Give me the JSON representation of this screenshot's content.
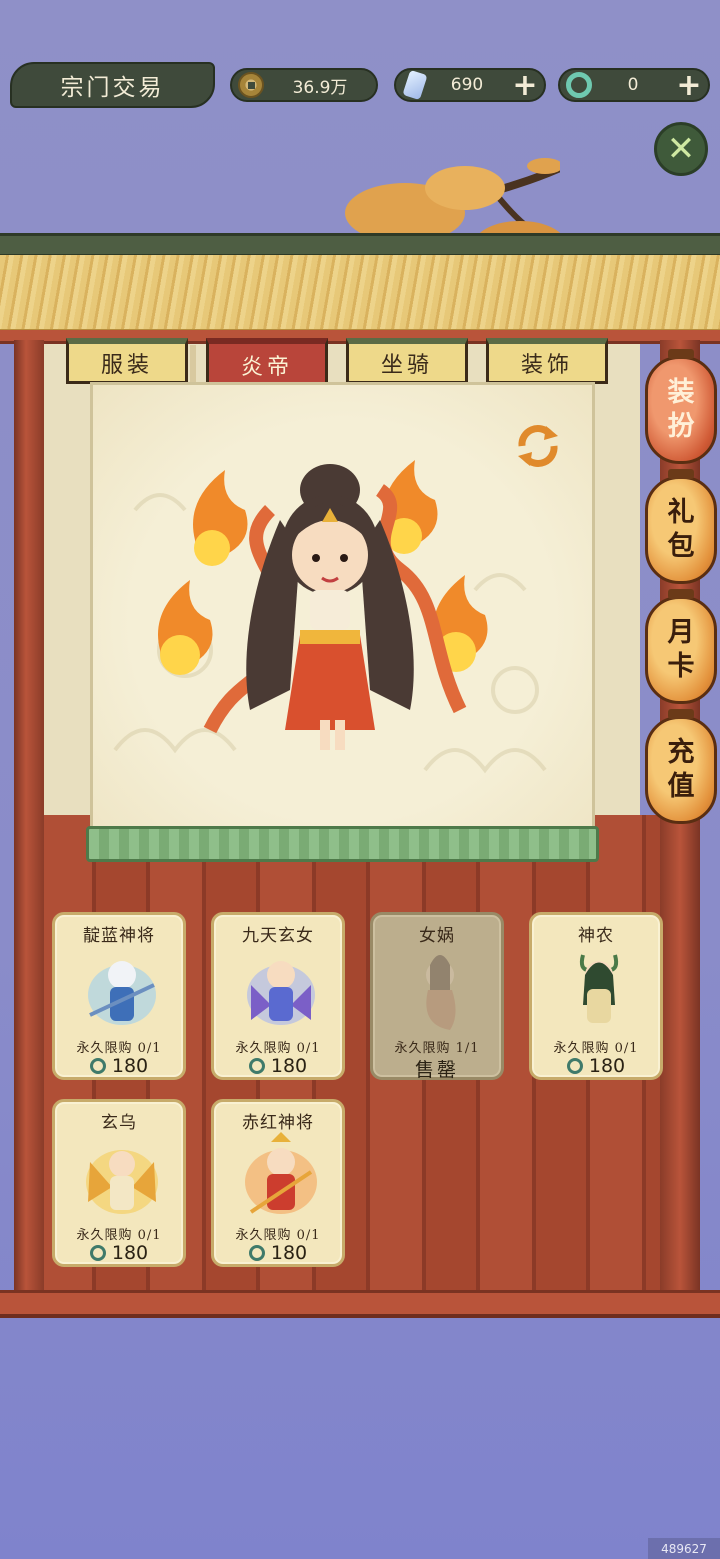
{
  "header": {
    "title": "宗门交易",
    "coins": "36.9万",
    "gems": "690",
    "jade": "0",
    "plus_label": "+",
    "close_label": "✕"
  },
  "tabs": [
    {
      "label": "服装"
    },
    {
      "label": "炎帝"
    },
    {
      "label": "坐骑"
    },
    {
      "label": "装饰"
    }
  ],
  "side_menu": [
    {
      "line1": "装",
      "line2": "扮"
    },
    {
      "line1": "礼",
      "line2": "包"
    },
    {
      "line1": "月",
      "line2": "卡"
    },
    {
      "line1": "充",
      "line2": "值"
    }
  ],
  "items": [
    {
      "name": "靛蓝神将",
      "limit": "永久限购 0/1",
      "price": "180",
      "palette": "blue"
    },
    {
      "name": "九天玄女",
      "limit": "永久限购 0/1",
      "price": "180",
      "palette": "violet"
    },
    {
      "name": "女娲",
      "limit": "永久限购 1/1",
      "sold_label": "售罄",
      "palette": "gray"
    },
    {
      "name": "神农",
      "limit": "永久限购 0/1",
      "price": "180",
      "palette": "green"
    },
    {
      "name": "玄乌",
      "limit": "永久限购 0/1",
      "price": "180",
      "palette": "gold"
    },
    {
      "name": "赤红神将",
      "limit": "永久限购 0/1",
      "price": "180",
      "palette": "red"
    }
  ],
  "watermark": "489627",
  "colors": {
    "background": "#8f90c8",
    "dark_green": "#3f4a3b",
    "active_tab": "#b9453a",
    "wood_red": "#b04f36",
    "card_bg": "#f3e7bd"
  }
}
